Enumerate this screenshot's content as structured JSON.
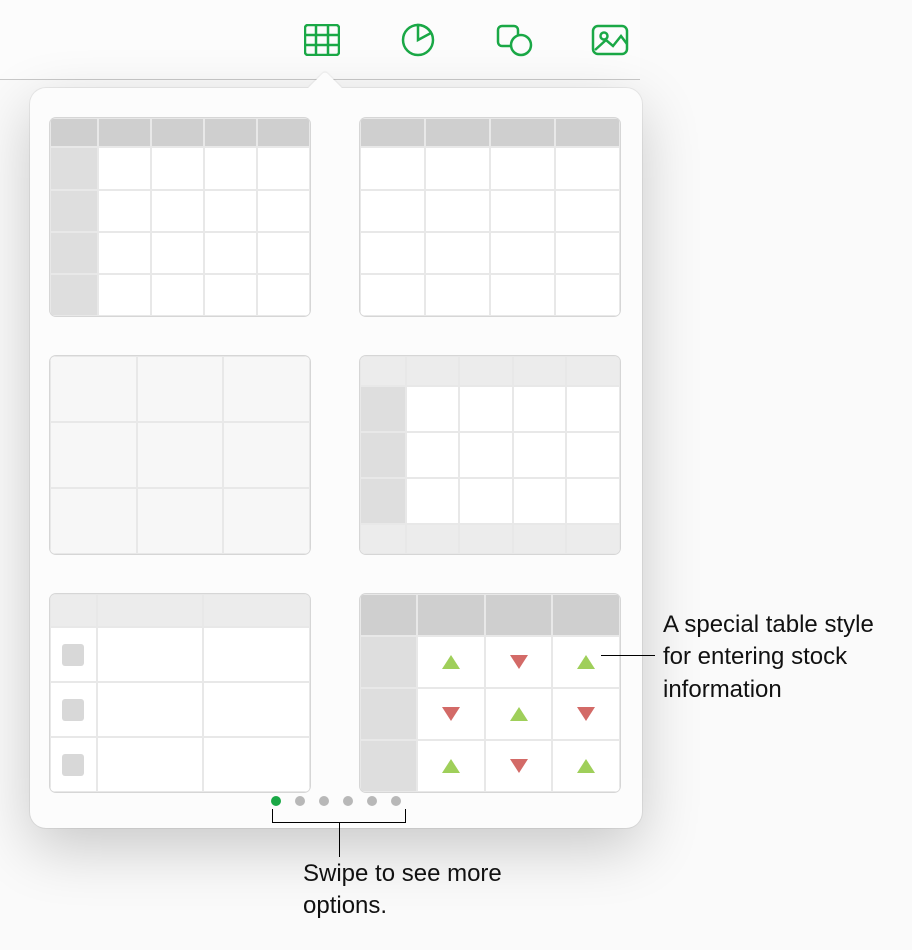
{
  "toolbar": {
    "icons": [
      "table",
      "chart",
      "shape",
      "media"
    ],
    "active": "table"
  },
  "popover": {
    "styles": [
      {
        "id": "headers-left-top"
      },
      {
        "id": "header-top-only"
      },
      {
        "id": "plain-3x3"
      },
      {
        "id": "full-borders"
      },
      {
        "id": "checklist"
      },
      {
        "id": "stock-arrows"
      }
    ],
    "page_dots": {
      "count": 6,
      "active_index": 0
    }
  },
  "callouts": {
    "stock": "A special table style for entering stock information",
    "swipe": "Swipe to see more options."
  },
  "colors": {
    "accent": "#1aa846",
    "up": "#9fcf5a",
    "down": "#d36a67"
  }
}
